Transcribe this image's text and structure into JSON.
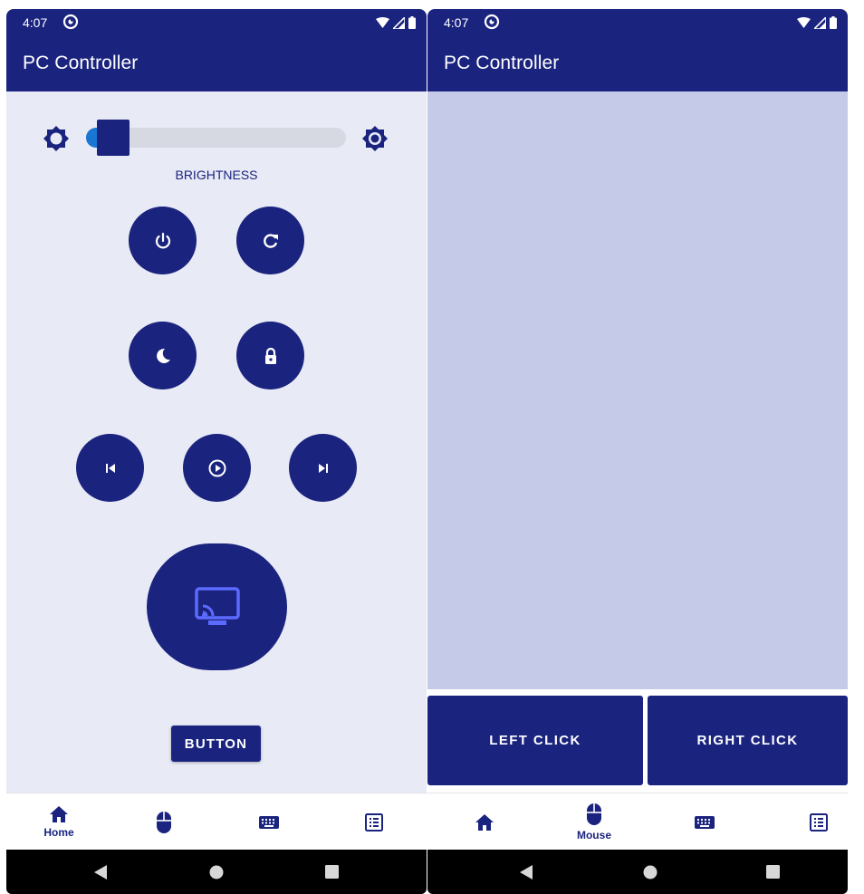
{
  "colors": {
    "primary": "#1a237e",
    "background": "#e8eaf6",
    "touchpad": "#c5cae9",
    "slider_fill": "#1976d2",
    "cast_icon": "#5c6bff"
  },
  "left": {
    "status": {
      "time": "4:07"
    },
    "appbar": {
      "title": "PC Controller"
    },
    "brightness": {
      "label": "BRIGHTNESS",
      "level": 0.05
    },
    "icons": {
      "brightness_low": "brightness-low-icon",
      "brightness_high": "brightness-high-icon",
      "power": "power-icon",
      "restart": "restart-icon",
      "sleep": "moon-icon",
      "lock": "lock-icon",
      "previous": "skip-previous-icon",
      "play": "play-circle-icon",
      "next": "skip-next-icon",
      "cast": "cast-icon"
    },
    "button_label": "BUTTON",
    "nav": [
      {
        "label": "Home",
        "icon": "home-icon",
        "selected": true
      },
      {
        "label": "",
        "icon": "mouse-icon",
        "selected": false
      },
      {
        "label": "",
        "icon": "keyboard-icon",
        "selected": false
      },
      {
        "label": "",
        "icon": "list-icon",
        "selected": false
      }
    ]
  },
  "right": {
    "status": {
      "time": "4:07"
    },
    "appbar": {
      "title": "PC Controller"
    },
    "left_click": "LEFT CLICK",
    "right_click": "RIGHT CLICK",
    "nav": [
      {
        "label": "",
        "icon": "home-icon",
        "selected": false
      },
      {
        "label": "Mouse",
        "icon": "mouse-icon",
        "selected": true
      },
      {
        "label": "",
        "icon": "keyboard-icon",
        "selected": false
      },
      {
        "label": "",
        "icon": "list-icon",
        "selected": false
      }
    ]
  }
}
